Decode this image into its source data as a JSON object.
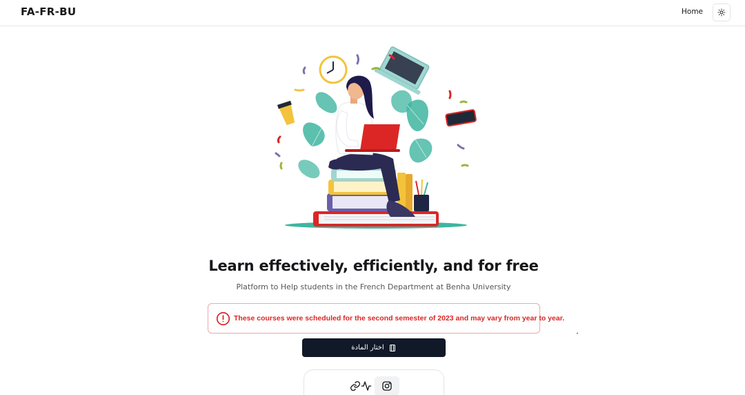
{
  "header": {
    "brand": "FA-FR-BU",
    "nav": {
      "home_label": "Home"
    },
    "theme_toggle_icon": "sun-icon"
  },
  "hero": {
    "illustration": "student-studying-on-books-illustration",
    "title": "Learn effectively, efficiently, and for free",
    "subtitle": "Platform to Help students in the French Department at Benha University"
  },
  "alert": {
    "icon": "alert-circle-icon",
    "text": "These courses were scheduled for the second semester of 2023 and may vary from year to year.",
    "color": "#dc2626"
  },
  "cta": {
    "label": "اختار المادة",
    "icon": "book-icon"
  },
  "social": {
    "icons": [
      "link-icon",
      "activity-icon",
      "instagram-icon"
    ],
    "active": "instagram-icon"
  },
  "colors": {
    "accent_dark": "#111827",
    "danger": "#dc2626",
    "teal": "#3fb5a0",
    "border": "#e4e4e7"
  }
}
